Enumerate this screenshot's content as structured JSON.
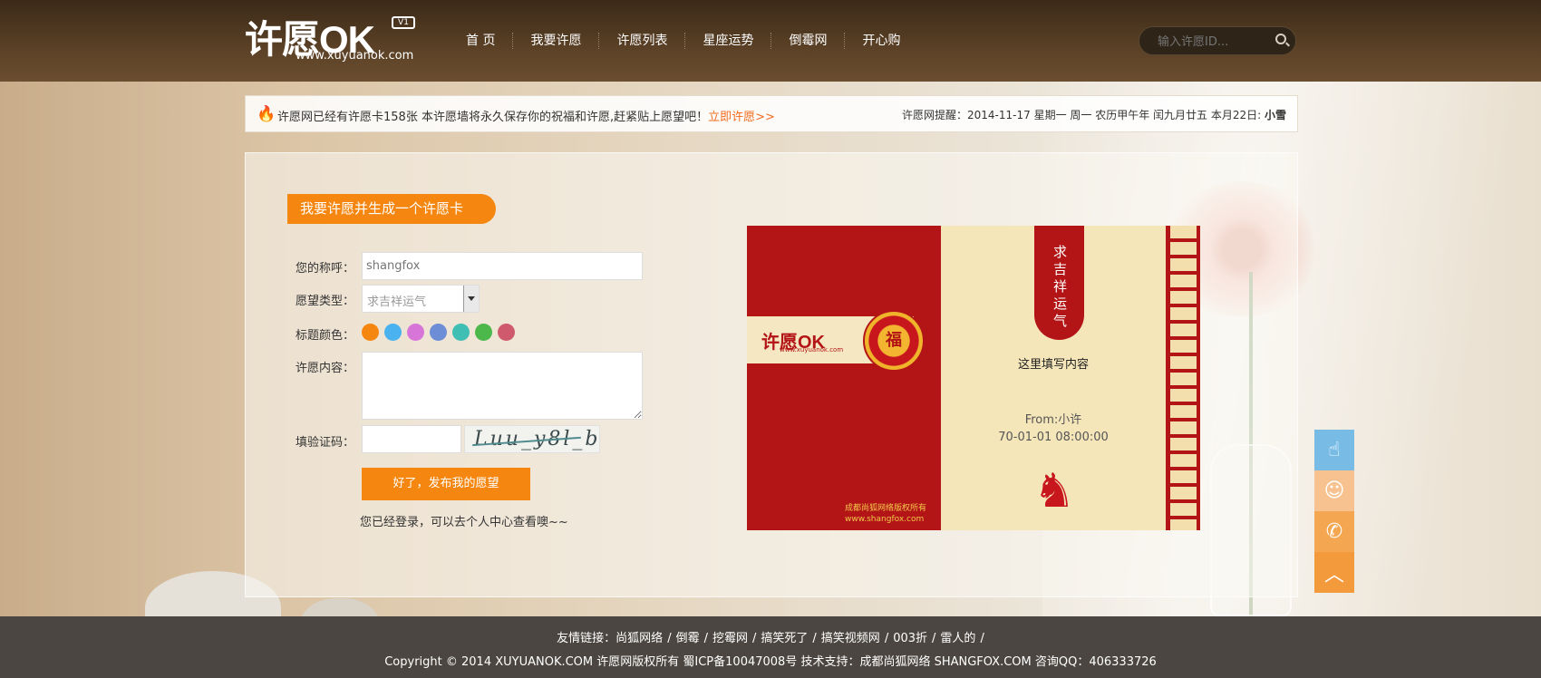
{
  "header": {
    "logo_text": "许愿OK",
    "logo_badge": "V1",
    "logo_url": "www.xuyuanok.com",
    "nav": [
      "首 页",
      "我要许愿",
      "许愿列表",
      "星座运势",
      "倒霉网",
      "开心购"
    ],
    "search_placeholder": "输入许愿ID..."
  },
  "notice": {
    "text": "许愿网已经有许愿卡158张   本许愿墙将永久保存你的祝福和许愿,赶紧贴上愿望吧！",
    "link": "立即许愿>>",
    "date": "许愿网提醒：2014-11-17 星期一   周一 农历甲午年 闰九月廿五 本月22日:",
    "date_bold": "小雪"
  },
  "form": {
    "tag": "我要许愿并生成一个许愿卡",
    "name_label": "您的称呼：",
    "name_placeholder": "shangfox",
    "type_label": "愿望类型：",
    "type_value": "求吉祥运气",
    "color_label": "标题颜色：",
    "colors": [
      "#f5860f",
      "#4ab3ef",
      "#d775d9",
      "#6d8dd6",
      "#3fbfb4",
      "#4cb84c",
      "#cf5a6e"
    ],
    "content_label": "许愿内容：",
    "captcha_label": "填验证码：",
    "captcha_text": "Luu_y8l_b",
    "submit": "好了，发布我的愿望",
    "login_note": "您已经登录，可以去个人中心查看噢~~"
  },
  "card": {
    "mini_logo": "许愿OK",
    "mini_url": "www.xuyuanok.com",
    "stamp": "福",
    "copyright_1": "成都尚狐网络版权所有",
    "copyright_2": "www.shangfox.com",
    "ribbon": "求吉祥运气",
    "content": "这里填写内容",
    "from": "From:小许",
    "time": "70-01-01 08:00:00"
  },
  "side_buttons": [
    "touch-icon",
    "qq-icon",
    "phone-icon",
    "top-arrow-icon"
  ],
  "footer": {
    "links_label": "友情链接：",
    "links": [
      "尚狐网络",
      "倒霉",
      "挖霉网",
      "搞笑死了",
      "搞笑视频网",
      "003折",
      "雷人的"
    ],
    "copyright": "Copyright © 2014 XUYUANOK.COM 许愿网版权所有 蜀ICP备10047008号  技术支持：成都尚狐网络 SHANGFOX.COM  咨询QQ：406333726"
  }
}
